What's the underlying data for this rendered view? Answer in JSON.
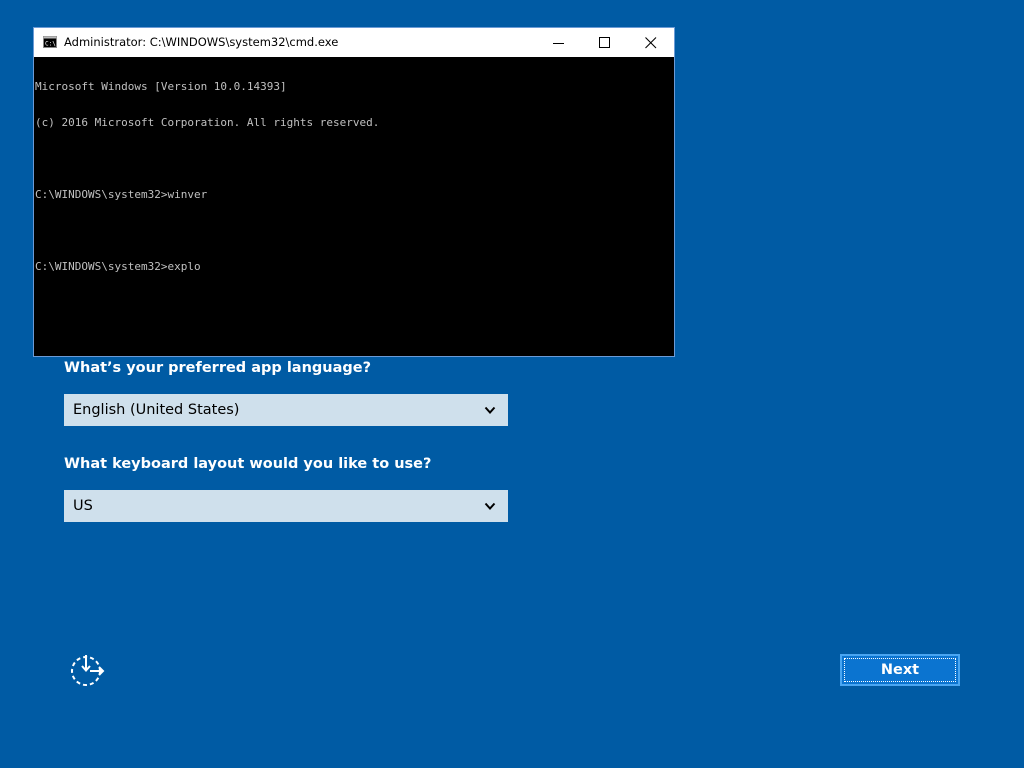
{
  "oobe": {
    "language_question": "What’s your preferred app language?",
    "language_selected": "English (United States)",
    "keyboard_question": "What keyboard layout would you like to use?",
    "keyboard_selected": "US",
    "next_label": "Next",
    "ease_of_access_icon": "ease-of-access-icon",
    "background_color": "#005ba4"
  },
  "cmd": {
    "title": "Administrator: C:\\WINDOWS\\system32\\cmd.exe",
    "lines": [
      "Microsoft Windows [Version 10.0.14393]",
      "(c) 2016 Microsoft Corporation. All rights reserved.",
      "",
      "C:\\WINDOWS\\system32>winver",
      "",
      "C:\\WINDOWS\\system32>explo"
    ]
  }
}
